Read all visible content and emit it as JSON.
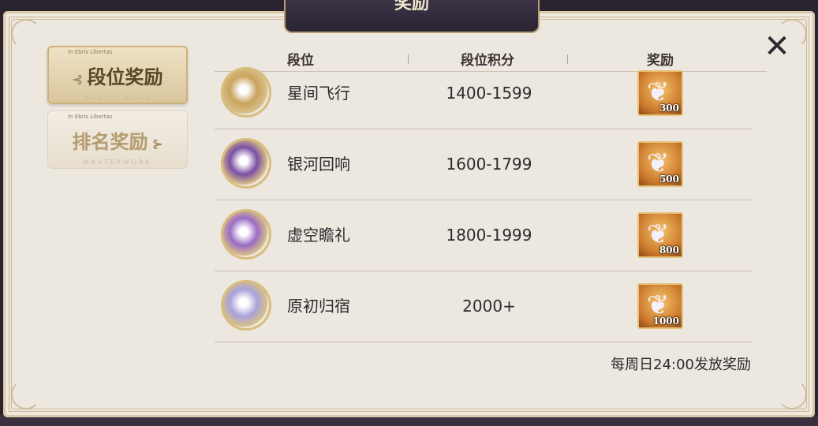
{
  "title": "奖励",
  "close_icon": "close-x-icon",
  "tabs": [
    {
      "label": "段位奖励",
      "small": "In Ebris Libertas",
      "sub": "MASTERWORK",
      "active": true
    },
    {
      "label": "排名奖励",
      "small": "In Ebris Libertas",
      "sub": "MASTERWORK",
      "active": false
    }
  ],
  "table": {
    "headers": [
      "段位",
      "段位积分",
      "奖励"
    ],
    "rows": [
      {
        "name": "星间飞行",
        "points": "1400-1599",
        "reward": "300",
        "icon": "rank-badge-icon",
        "color": "#c9a45e"
      },
      {
        "name": "银河回响",
        "points": "1600-1799",
        "reward": "500",
        "icon": "rank-badge-icon",
        "color": "#7a4fa3"
      },
      {
        "name": "虚空瞻礼",
        "points": "1800-1999",
        "reward": "800",
        "icon": "rank-badge-icon",
        "color": "#9a6bc4"
      },
      {
        "name": "原初归宿",
        "points": "2000+",
        "reward": "1000",
        "icon": "rank-badge-icon",
        "color": "#a9a2d8"
      }
    ]
  },
  "footer": "每周日24:00发放奖励",
  "colors": {
    "accent": "#b79e72",
    "panel": "#ece7df"
  }
}
